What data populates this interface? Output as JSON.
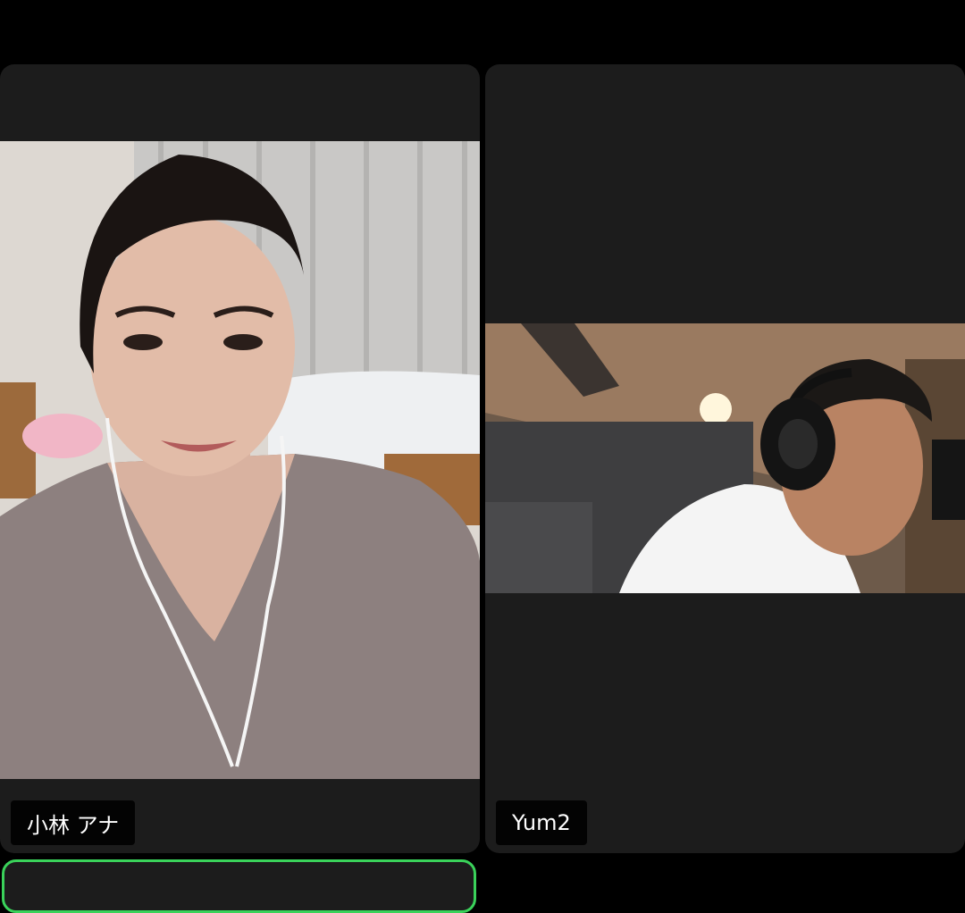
{
  "meeting": {
    "participants": [
      {
        "name": "小林 アナ",
        "video": "woman-selfie-bedroom-video"
      },
      {
        "name": "Yum2",
        "video": "man-headphones-studio-video"
      },
      {
        "name": "",
        "video": "active-speaker-tile"
      }
    ],
    "colors": {
      "background": "#000000",
      "tile": "#1c1c1c",
      "active_border": "#3ad25a",
      "name_text": "#ffffff"
    }
  }
}
